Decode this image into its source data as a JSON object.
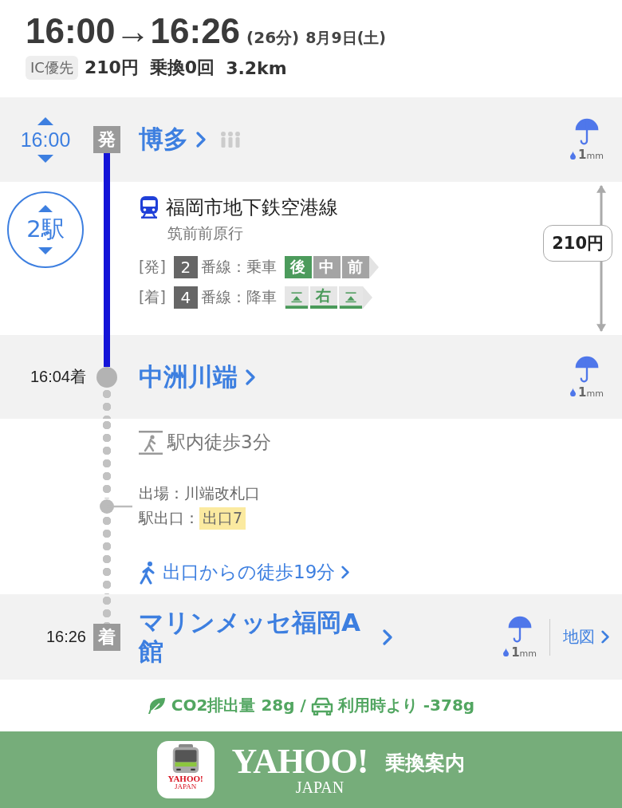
{
  "summary": {
    "departure_time": "16:00",
    "arrow": "→",
    "arrival_time": "16:26",
    "duration": "(26分)",
    "date": "8月9日(土)",
    "badge": "IC優先",
    "fare": "210円",
    "transfers": "乗換0回",
    "distance": "3.2km"
  },
  "departure": {
    "time": "16:00",
    "mark": "発",
    "name": "博多",
    "rain": {
      "amount": "1",
      "unit": "mm"
    }
  },
  "ride": {
    "stops": "2駅",
    "line": "福岡市地下鉄空港線",
    "direction": "筑前前原行",
    "fare": "210円",
    "boarding": {
      "tag": "[発]",
      "track": "2",
      "text": "番線：乗車",
      "cars": [
        {
          "kind": "car",
          "label": "後",
          "selected": true
        },
        {
          "kind": "car",
          "label": "中",
          "selected": false
        },
        {
          "kind": "car",
          "label": "前",
          "selected": false
        }
      ]
    },
    "alighting": {
      "tag": "[着]",
      "track": "4",
      "text": "番線：降車",
      "cars": [
        {
          "kind": "stairs"
        },
        {
          "kind": "side",
          "label": "右"
        },
        {
          "kind": "stairs"
        }
      ]
    }
  },
  "transfer_station": {
    "time": "16:04着",
    "name": "中洲川端",
    "rain": {
      "amount": "1",
      "unit": "mm"
    }
  },
  "walk": {
    "station_walk": "駅内徒歩3分",
    "exit_gate": "出場：川端改札口",
    "exit_label": "駅出口：",
    "exit": "出口7",
    "walk_link": "出口からの徒歩19分"
  },
  "arrival": {
    "time": "16:26",
    "mark": "着",
    "name": "マリンメッセ福岡A館",
    "rain": {
      "amount": "1",
      "unit": "mm"
    },
    "map": "地図"
  },
  "co2": {
    "text": "CO2排出量 28g /",
    "car_text": "利用時より -378g"
  },
  "footer": {
    "icon_logo": "YAHOO!",
    "icon_sub": "JAPAN",
    "logo": "YAHOO!",
    "logo_sub": "JAPAN",
    "service": "乗換案内"
  }
}
